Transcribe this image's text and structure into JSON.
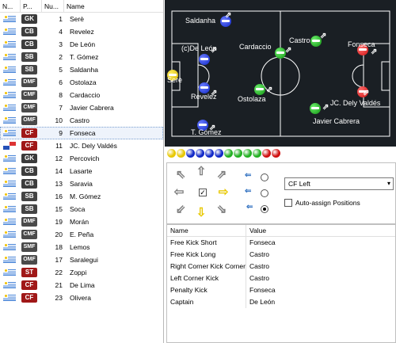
{
  "list": {
    "headers": {
      "nat": "N...",
      "pos": "P...",
      "num": "Nu...",
      "name": "Name"
    },
    "players": [
      {
        "flag": "uru",
        "pos": "GK",
        "num": "1",
        "name": "Serè"
      },
      {
        "flag": "uru",
        "pos": "CB",
        "num": "4",
        "name": "Revelez"
      },
      {
        "flag": "uru",
        "pos": "CB",
        "num": "3",
        "name": "De León"
      },
      {
        "flag": "uru",
        "pos": "SB",
        "num": "2",
        "name": "T. Gómez"
      },
      {
        "flag": "uru",
        "pos": "SB",
        "num": "5",
        "name": "Saldanha"
      },
      {
        "flag": "uru",
        "pos": "DMF",
        "num": "6",
        "name": "Ostolaza"
      },
      {
        "flag": "uru",
        "pos": "CMF",
        "num": "8",
        "name": "Cardaccio"
      },
      {
        "flag": "uru",
        "pos": "CMF",
        "num": "7",
        "name": "Javier Cabrera"
      },
      {
        "flag": "uru",
        "pos": "OMF",
        "num": "10",
        "name": "Castro"
      },
      {
        "flag": "uru",
        "pos": "CF",
        "num": "9",
        "name": "Fonseca"
      },
      {
        "flag": "pan",
        "pos": "CF",
        "num": "11",
        "name": "JC. Dely Valdés"
      },
      {
        "flag": "uru",
        "pos": "GK",
        "num": "12",
        "name": "Percovich"
      },
      {
        "flag": "uru",
        "pos": "CB",
        "num": "14",
        "name": "Lasarte"
      },
      {
        "flag": "uru",
        "pos": "CB",
        "num": "13",
        "name": "Saravia"
      },
      {
        "flag": "uru",
        "pos": "SB",
        "num": "16",
        "name": "M. Gómez"
      },
      {
        "flag": "uru",
        "pos": "SB",
        "num": "15",
        "name": "Soca"
      },
      {
        "flag": "uru",
        "pos": "DMF",
        "num": "19",
        "name": "Morán"
      },
      {
        "flag": "uru",
        "pos": "CMF",
        "num": "20",
        "name": "E. Peña"
      },
      {
        "flag": "uru",
        "pos": "SMF",
        "num": "18",
        "name": "Lemos"
      },
      {
        "flag": "uru",
        "pos": "OMF",
        "num": "17",
        "name": "Saralegui"
      },
      {
        "flag": "uru",
        "pos": "ST",
        "num": "22",
        "name": "Zoppi"
      },
      {
        "flag": "uru",
        "pos": "CF",
        "num": "21",
        "name": "De Lima"
      },
      {
        "flag": "uru",
        "pos": "CF",
        "num": "23",
        "name": "Olivera"
      }
    ],
    "selected_index": 9
  },
  "pitch": {
    "players": [
      {
        "name": "Serè",
        "color": "yellow"
      },
      {
        "name": "(c)De León",
        "color": "blue"
      },
      {
        "name": "Revelez",
        "color": "blue"
      },
      {
        "name": "Saldanha",
        "color": "blue"
      },
      {
        "name": "T. Gómez",
        "color": "blue"
      },
      {
        "name": "Cardaccio",
        "color": "green"
      },
      {
        "name": "Ostolaza",
        "color": "green"
      },
      {
        "name": "Castro",
        "color": "green"
      },
      {
        "name": "Javier Cabrera",
        "color": "green"
      },
      {
        "name": "Fonseca",
        "color": "red"
      },
      {
        "name": "JC. Dely Valdés",
        "color": "red"
      }
    ]
  },
  "colors": {
    "pitch": "#1a1f24",
    "balls": [
      "#e8c800",
      "#e8c800",
      "#1028c8",
      "#1028c8",
      "#1028c8",
      "#1028c8",
      "#22b022",
      "#22b022",
      "#22b022",
      "#22b022",
      "#d01010",
      "#d01010"
    ]
  },
  "controls": {
    "formation_select": "CF Left",
    "auto_assign_label": "Auto-assign Positions",
    "arrows": [
      "arrow-up-left",
      "arrow-up",
      "arrow-up-right",
      "arrow-left",
      "check",
      "arrow-right",
      "arrow-down-left",
      "arrow-down",
      "arrow-down-right"
    ]
  },
  "roles": {
    "headers": {
      "name": "Name",
      "value": "Value"
    },
    "rows": [
      {
        "name": "Free Kick Short",
        "value": "Fonseca"
      },
      {
        "name": "Free Kick Long",
        "value": "Castro"
      },
      {
        "name": "Right Corner Kick Corner",
        "value": "Castro"
      },
      {
        "name": "Left Corner Kick",
        "value": "Castro"
      },
      {
        "name": "Penalty Kick",
        "value": "Fonseca"
      },
      {
        "name": "Captain",
        "value": "De León"
      }
    ]
  }
}
